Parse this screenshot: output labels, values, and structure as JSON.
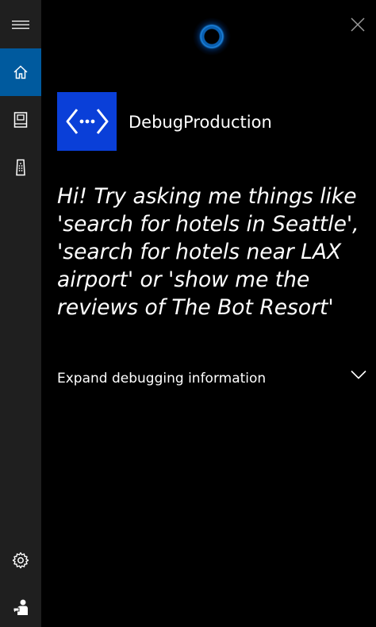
{
  "window": {
    "close_icon": "close-icon"
  },
  "sidebar": {
    "items": [
      {
        "name": "menu",
        "icon": "hamburger-icon"
      },
      {
        "name": "home",
        "icon": "home-icon",
        "active": true
      },
      {
        "name": "notebook",
        "icon": "notebook-icon"
      },
      {
        "name": "devices",
        "icon": "speaker-icon"
      },
      {
        "name": "settings",
        "icon": "gear-icon"
      },
      {
        "name": "feedback",
        "icon": "feedback-icon"
      }
    ],
    "colors": {
      "background": "#1f1f1f",
      "active": "#005a9e"
    }
  },
  "assistant": {
    "indicator": "cortana-ring-icon"
  },
  "bot": {
    "name": "DebugProduction",
    "logo_icon": "code-brackets-icon",
    "logo_color": "#0a3fd8"
  },
  "message": {
    "greeting": "Hi! Try asking me things like 'search for hotels in Seattle', 'search for hotels near LAX airport' or 'show me the reviews of The Bot Resort'"
  },
  "debug": {
    "expand_label": "Expand debugging information",
    "chevron_icon": "chevron-down-icon"
  }
}
